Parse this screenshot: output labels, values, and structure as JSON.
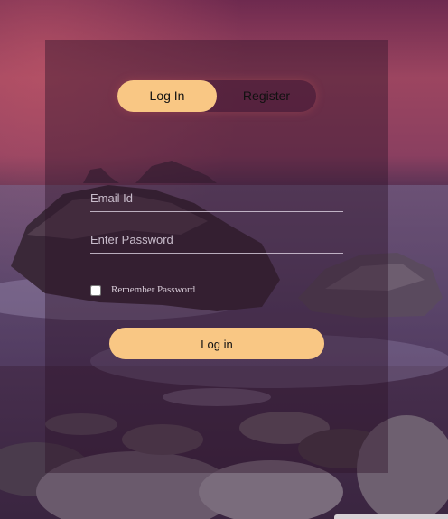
{
  "tabs": {
    "login_label": "Log In",
    "register_label": "Register"
  },
  "form": {
    "email_placeholder": "Email Id",
    "password_placeholder": "Enter Password",
    "remember_label": "Remember Password",
    "submit_label": "Log in"
  },
  "colors": {
    "accent": "#f9c784",
    "panel": "rgba(45,18,40,0.42)",
    "sky_top": "#a14a63",
    "sea": "#4a2d4e"
  },
  "background": "purple-seascape-with-rocks-image"
}
